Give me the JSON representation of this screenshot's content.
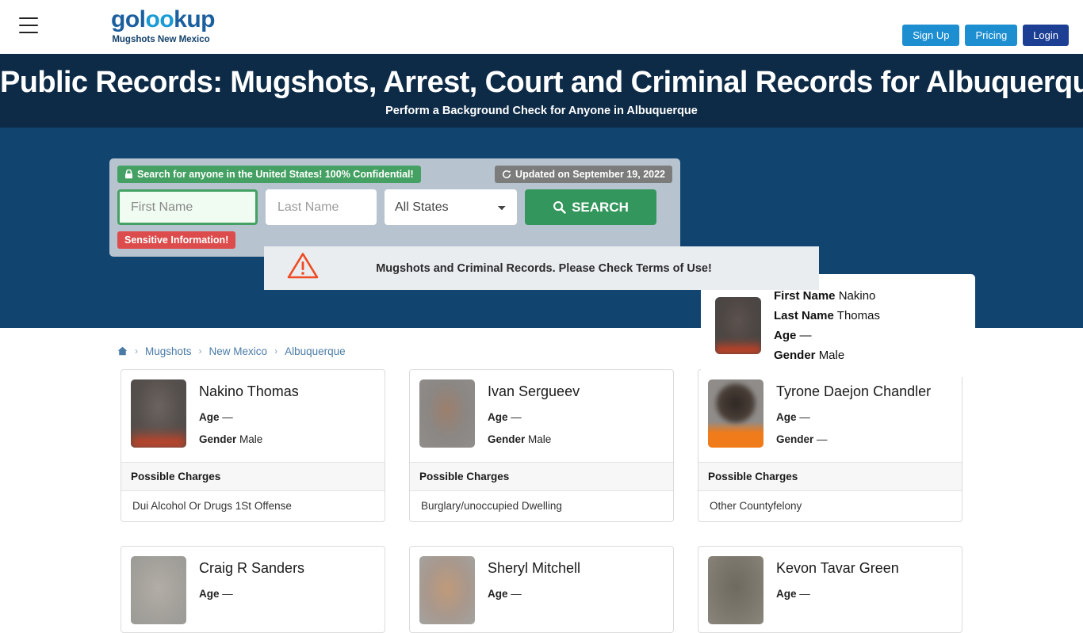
{
  "header": {
    "menu_icon": "hamburger-icon",
    "logo_text_before": "gol",
    "logo_text_oo": "oo",
    "logo_text_after": "kup",
    "logo_subtitle": "Mugshots New Mexico",
    "buttons": {
      "signup": "Sign Up",
      "pricing": "Pricing",
      "login": "Login"
    },
    "colors": {
      "signup_bg": "#1d8fd1",
      "pricing_bg": "#1d8fd1",
      "login_bg": "#1c3f94",
      "logo_blue": "#1b5f9e",
      "logo_accent": "#1b9ad6"
    }
  },
  "hero": {
    "title": "Public Records: Mugshots, Arrest, Court and Criminal Records for Albuquerque!",
    "subtitle": "Perform a Background Check for Anyone in Albuquerque",
    "band_color": "#0d2b47",
    "body_color": "#11456f"
  },
  "search": {
    "confidential_badge": "Search for anyone in the United States! 100% Confidential!",
    "confidential_icon": "lock-icon",
    "updated_badge": "Updated on September 19, 2022",
    "updated_icon": "refresh-icon",
    "first_name_placeholder": "First Name",
    "first_name_value": "",
    "last_name_placeholder": "Last Name",
    "last_name_value": "",
    "state_selected": "All States",
    "state_options": [
      "All States"
    ],
    "search_button": "SEARCH",
    "search_icon": "search-icon",
    "sensitive_badge": "Sensitive Information!",
    "colors": {
      "panel_bg": "#b7c4d0",
      "green": "#45a163",
      "search_green": "#33965c",
      "grey": "#7c7c7c",
      "red": "#dc4c4c"
    }
  },
  "info_card": {
    "photo": "mugshot-thumbnail",
    "rows": [
      {
        "label": "First Name",
        "value": "Nakino"
      },
      {
        "label": "Last Name",
        "value": "Thomas"
      },
      {
        "label": "Age",
        "value": "—"
      },
      {
        "label": "Gender",
        "value": "Male"
      }
    ]
  },
  "warning": {
    "icon": "warning-triangle-icon",
    "text": "Mugshots and Criminal Records. Please Check Terms of Use!",
    "bg": "#e9edf0",
    "icon_color": "#ef4a21"
  },
  "breadcrumb": {
    "home_icon": "home-icon",
    "separator": "›",
    "items": [
      "Mugshots",
      "New Mexico",
      "Albuquerque"
    ]
  },
  "results": {
    "age_label": "Age",
    "gender_label": "Gender",
    "charges_header": "Possible Charges",
    "cards": [
      {
        "name": "Nakino Thomas",
        "age": "—",
        "gender": "Male",
        "charge": "Dui Alcohol Or Drugs 1St Offense",
        "photo_class": "ph-grey-dark"
      },
      {
        "name": "Ivan Sergueev",
        "age": "—",
        "gender": "Male",
        "charge": "Burglary/unoccupied Dwelling",
        "photo_class": "ph-grey-med"
      },
      {
        "name": "Tyrone Daejon Chandler",
        "age": "—",
        "gender": "—",
        "charge": "Other Countyfelony",
        "photo_class": "ph-orange"
      },
      {
        "name": "Craig R Sanders",
        "age": "—",
        "gender": "",
        "charge": "",
        "photo_class": "ph-light-grey"
      },
      {
        "name": "Sheryl Mitchell",
        "age": "—",
        "gender": "",
        "charge": "",
        "photo_class": "ph-warm"
      },
      {
        "name": "Kevon Tavar Green",
        "age": "—",
        "gender": "",
        "charge": "",
        "photo_class": "ph-olive"
      }
    ]
  }
}
